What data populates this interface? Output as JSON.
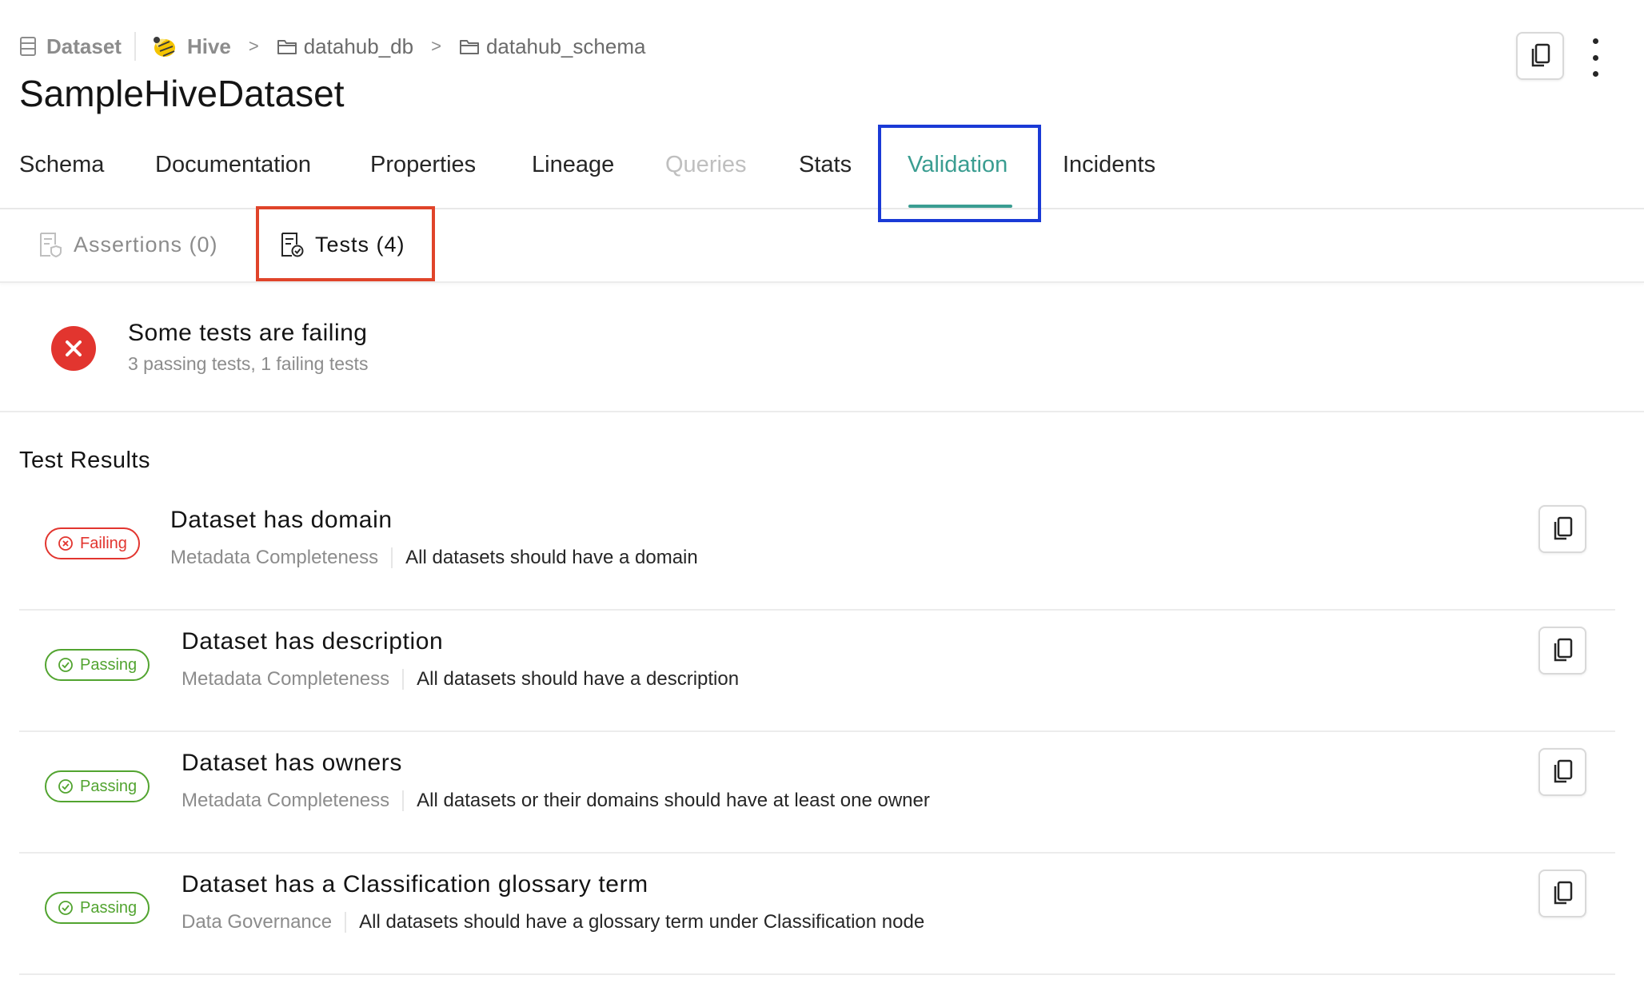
{
  "breadcrumb": {
    "entity_type": "Dataset",
    "platform": "Hive",
    "path": [
      "datahub_db",
      "datahub_schema"
    ],
    "separator": ">"
  },
  "page_title": "SampleHiveDataset",
  "tabs": [
    {
      "label": "Schema",
      "state": "normal"
    },
    {
      "label": "Documentation",
      "state": "normal"
    },
    {
      "label": "Properties",
      "state": "normal"
    },
    {
      "label": "Lineage",
      "state": "normal"
    },
    {
      "label": "Queries",
      "state": "disabled"
    },
    {
      "label": "Stats",
      "state": "normal"
    },
    {
      "label": "Validation",
      "state": "active"
    },
    {
      "label": "Incidents",
      "state": "normal"
    }
  ],
  "subtabs": {
    "assertions": "Assertions (0)",
    "tests": "Tests (4)"
  },
  "summary": {
    "icon": "x",
    "title": "Some tests are failing",
    "subtitle": "3 passing tests, 1 failing tests"
  },
  "results_heading": "Test Results",
  "tests": [
    {
      "status": "Failing",
      "name": "Dataset has domain",
      "category": "Metadata Completeness",
      "description": "All datasets should have a domain"
    },
    {
      "status": "Passing",
      "name": "Dataset has description",
      "category": "Metadata Completeness",
      "description": "All datasets should have a description"
    },
    {
      "status": "Passing",
      "name": "Dataset has owners",
      "category": "Metadata Completeness",
      "description": "All datasets or their domains should have at least one owner"
    },
    {
      "status": "Passing",
      "name": "Dataset has a Classification glossary term",
      "category": "Data Governance",
      "description": "All datasets should have a glossary term under Classification node"
    }
  ],
  "colors": {
    "accent": "#3a9d91",
    "failing": "#e2352f",
    "passing": "#52a430",
    "highlight_blue": "#1a3ad6",
    "highlight_red": "#e0442a"
  },
  "icons": {
    "entity": "table-icon",
    "platform": "hive-logo-icon",
    "folder": "folder-icon",
    "copy": "copy-icon",
    "more": "kebab-menu-icon"
  }
}
